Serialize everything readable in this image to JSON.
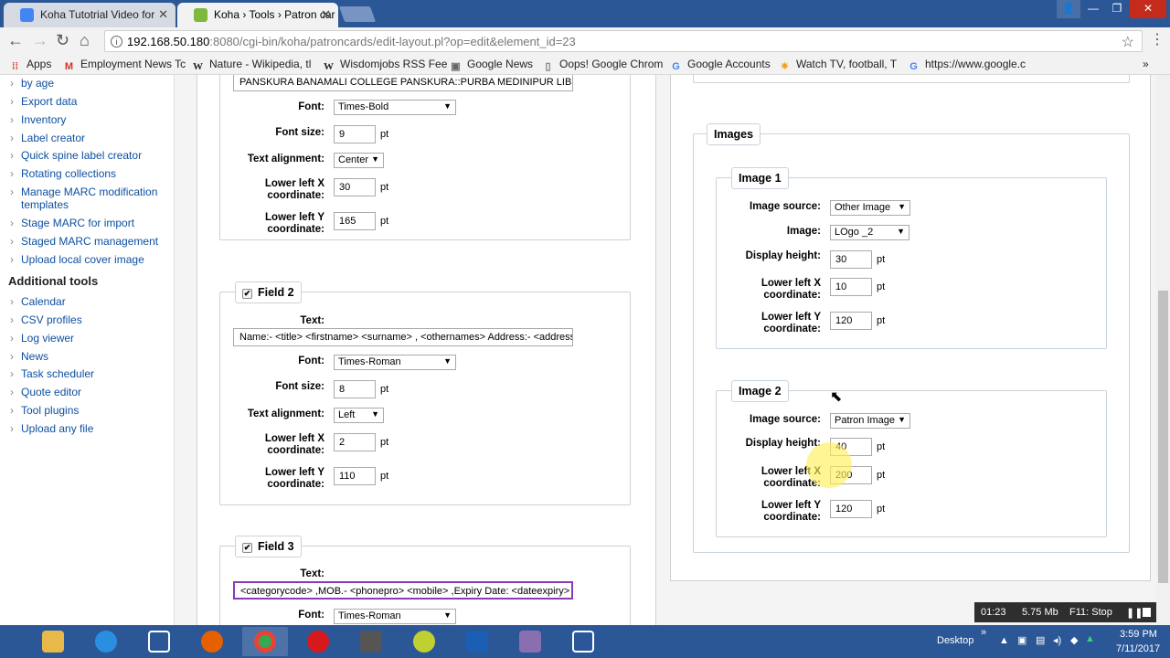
{
  "browser": {
    "tabs": [
      {
        "title": "Koha Tutotrial Video for",
        "active": false
      },
      {
        "title": "Koha › Tools › Patron car",
        "active": true
      }
    ],
    "url": {
      "host": "192.168.50.180",
      "rest": ":8080/cgi-bin/koha/patroncards/edit-layout.pl?op=edit&element_id=23"
    },
    "bookmarks": [
      "Apps",
      "Employment News Tc",
      "Nature - Wikipedia, tl",
      "Wisdomjobs RSS Fee",
      "Google News",
      "Oops! Google Chrom",
      "Google Accounts",
      "Watch TV, football, T",
      "https://www.google.c"
    ],
    "overflow": "»"
  },
  "sidebar": {
    "items_top": [
      "by age",
      "Export data",
      "Inventory",
      "Label creator",
      "Quick spine label creator",
      "Rotating collections",
      "Manage MARC modification templates",
      "Stage MARC for import",
      "Staged MARC management",
      "Upload local cover image"
    ],
    "heading": "Additional tools",
    "items_bottom": [
      "Calendar",
      "CSV profiles",
      "Log viewer",
      "News",
      "Task scheduler",
      "Quote editor",
      "Tool plugins",
      "Upload any file"
    ]
  },
  "labels": {
    "text": "Text:",
    "font": "Font:",
    "font_size": "Font size:",
    "alignment": "Text alignment:",
    "llx": "Lower left X coordinate:",
    "lly": "Lower left Y coordinate:",
    "pt": "pt",
    "image_source": "Image source:",
    "image": "Image:",
    "display_height": "Display height:"
  },
  "field1": {
    "text": "PANSKURA BANAMALI COLLEGE PANSKURA::PURBA MEDINIPUR LIB",
    "font": "Times-Bold",
    "font_size": "9",
    "alignment": "Center",
    "llx": "30",
    "lly": "165"
  },
  "field2": {
    "title": "Field 2",
    "text": "Name:- <title> <firstname> <surname> , <othernames> Address:- <address>",
    "font": "Times-Roman",
    "font_size": "8",
    "alignment": "Left",
    "llx": "2",
    "lly": "110"
  },
  "field3": {
    "title": "Field 3",
    "text": "<categorycode> ,MOB.- <phonepro> <mobile> ,Expiry Date: <dateexpiry>",
    "font": "Times-Roman"
  },
  "images": {
    "title": "Images",
    "image1": {
      "title": "Image 1",
      "source": "Other Image",
      "image": "LOgo _2",
      "height": "30",
      "llx": "10",
      "lly": "120"
    },
    "image2": {
      "title": "Image 2",
      "source": "Patron Image",
      "height": "40",
      "llx": "200",
      "lly": "120"
    }
  },
  "recorder": {
    "time": "01:23",
    "size": "5.75 Mb",
    "stop": "F11: Stop"
  },
  "taskbar": {
    "desktop": "Desktop",
    "time": "3:59 PM",
    "date": "7/11/2017",
    "icons": [
      "file-explorer-icon",
      "internet-explorer-icon",
      "snipping-icon",
      "firefox-icon",
      "chrome-icon",
      "opera-icon",
      "camera-icon",
      "paint-icon",
      "maxthon-icon",
      "koha-icon",
      "word-icon"
    ]
  },
  "colors": {
    "tabstrip": "#2b5797",
    "taskbar": "#2b5797",
    "link": "#0d50a0"
  }
}
